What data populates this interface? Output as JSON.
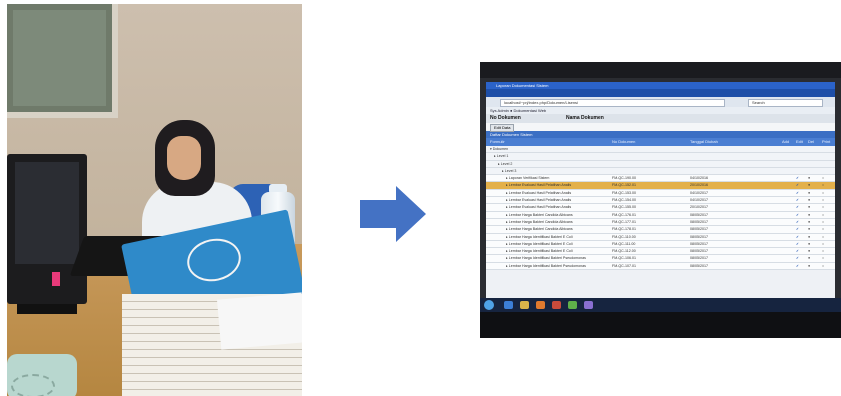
{
  "browser": {
    "title": "Laporan Dokumentasi Sistem",
    "tab_label": "Laporan Dokumentasi Sistem",
    "url": "localhost/~prj/index.php/Dokumen/Lisensi",
    "search_placeholder": "Search",
    "bookmarks": "Sys Admin  ●  Dokumentasi Web"
  },
  "document": {
    "no_label": "No Dokumen",
    "name_label": "Nama Dokumen",
    "action_button": "Edit Data",
    "section_title": "Daftar Dokumen Sistem"
  },
  "grid": {
    "headers": [
      "Formulir",
      "No Dokumen",
      "Tanggal Diubah",
      "Add",
      "Edit",
      "Del",
      "Print"
    ],
    "tree": [
      "Dokumen",
      "Level 1",
      "Level 2",
      "Level 3"
    ],
    "rows": [
      {
        "name": "Laporan Verifikasi Sistem",
        "no": "FM-QC-190.00",
        "date": "04/10/2016",
        "hl": false
      },
      {
        "name": "Lembar Evaluasi Hasil Pelatihan Analis",
        "no": "FM-QC-152.01",
        "date": "20/10/2016",
        "hl": true
      },
      {
        "name": "Lembar Evaluasi Hasil Pelatihan Analis",
        "no": "FM-QC-153.00",
        "date": "04/10/2017",
        "hl": false
      },
      {
        "name": "Lembar Evaluasi Hasil Pelatihan Analis",
        "no": "FM-QC-154.00",
        "date": "04/10/2017",
        "hl": false
      },
      {
        "name": "Lembar Evaluasi Hasil Pelatihan Analis",
        "no": "FM-QC-155.00",
        "date": "20/10/2017",
        "hl": false
      },
      {
        "name": "Lembar Harga Bakteri Candida Albicans",
        "no": "FM-QC-176.01",
        "date": "08/05/2017",
        "hl": false
      },
      {
        "name": "Lembar Harga Bakteri Candida Albicans",
        "no": "FM-QC-177.01",
        "date": "08/05/2017",
        "hl": false
      },
      {
        "name": "Lembar Harga Bakteri Candida Albicans",
        "no": "FM-QC-178.01",
        "date": "08/05/2017",
        "hl": false
      },
      {
        "name": "Lembar Harga Identifikasi Bakteri E Coli",
        "no": "FM-QC-110.00",
        "date": "08/05/2017",
        "hl": false
      },
      {
        "name": "Lembar Harga Identifikasi Bakteri E Coli",
        "no": "FM-QC-111.00",
        "date": "08/05/2017",
        "hl": false
      },
      {
        "name": "Lembar Harga Identifikasi Bakteri E Coli",
        "no": "FM-QC-112.00",
        "date": "08/05/2017",
        "hl": false
      },
      {
        "name": "Lembar Harga Identifikasi Bakteri Pseudomonas",
        "no": "FM-QC-106.01",
        "date": "08/05/2017",
        "hl": false
      },
      {
        "name": "Lembar Harga Identifikasi Bakteri Pseudomonas",
        "no": "FM-QC-107.01",
        "date": "08/05/2017",
        "hl": false
      }
    ]
  },
  "colors": {
    "arrow": "#4472c4",
    "highlight_row": "#e3b04a",
    "header_blue": "#4a7ed2"
  }
}
